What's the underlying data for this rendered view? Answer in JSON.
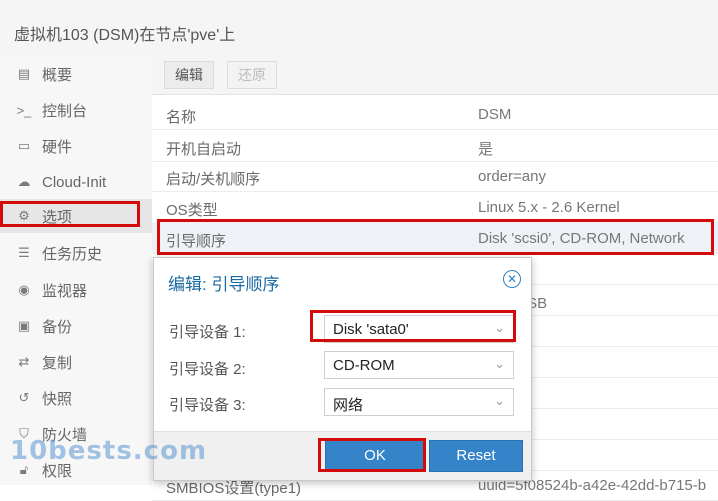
{
  "window": {
    "title": "虚拟机103 (DSM)在节点'pve'上"
  },
  "sidebar": {
    "items": [
      {
        "label": "概要",
        "icon": "book-icon"
      },
      {
        "label": "控制台",
        "icon": "terminal-icon"
      },
      {
        "label": "硬件",
        "icon": "monitor-icon"
      },
      {
        "label": "Cloud-Init",
        "icon": "cloud-icon"
      },
      {
        "label": "选项",
        "icon": "gear-icon",
        "active": true
      },
      {
        "label": "任务历史",
        "icon": "list-icon"
      },
      {
        "label": "监视器",
        "icon": "eye-icon"
      },
      {
        "label": "备份",
        "icon": "floppy-icon"
      },
      {
        "label": "复制",
        "icon": "retweet-icon"
      },
      {
        "label": "快照",
        "icon": "history-icon"
      },
      {
        "label": "防火墙",
        "icon": "shield-icon"
      },
      {
        "label": "权限",
        "icon": "unlock-icon"
      }
    ]
  },
  "toolbar": {
    "edit_label": "编辑",
    "revert_label": "还原"
  },
  "options": {
    "rows": [
      {
        "key": "名称",
        "value": "DSM"
      },
      {
        "key": "开机自启动",
        "value": "是"
      },
      {
        "key": "启动/关机顺序",
        "value": "order=any"
      },
      {
        "key": "OS类型",
        "value": "Linux 5.x - 2.6 Kernel"
      },
      {
        "key": "引导顺序",
        "value": "Disk 'scsi0', CD-ROM, Network"
      },
      {
        "key": "",
        "value": ""
      },
      {
        "key": "",
        "value": "网络, USB"
      },
      {
        "key": "",
        "value": ""
      },
      {
        "key": "",
        "value": ""
      },
      {
        "key": "",
        "value": ""
      },
      {
        "key": "",
        "value": ""
      },
      {
        "key": "",
        "value": ""
      },
      {
        "key": "SMBIOS设置(type1)",
        "value": "uuid=5f08524b-a42e-42dd-b715-b"
      }
    ]
  },
  "dialog": {
    "title": "编辑: 引导顺序",
    "fields": [
      {
        "label": "引导设备 1:",
        "value": "Disk 'sata0'"
      },
      {
        "label": "引导设备 2:",
        "value": "CD-ROM"
      },
      {
        "label": "引导设备 3:",
        "value": "网络"
      }
    ],
    "ok_label": "OK",
    "reset_label": "Reset"
  },
  "watermark": "10bests.com",
  "colors": {
    "accent": "#3584c9",
    "highlight": "#d40b0b",
    "dialog_title": "#1a6aa2"
  }
}
